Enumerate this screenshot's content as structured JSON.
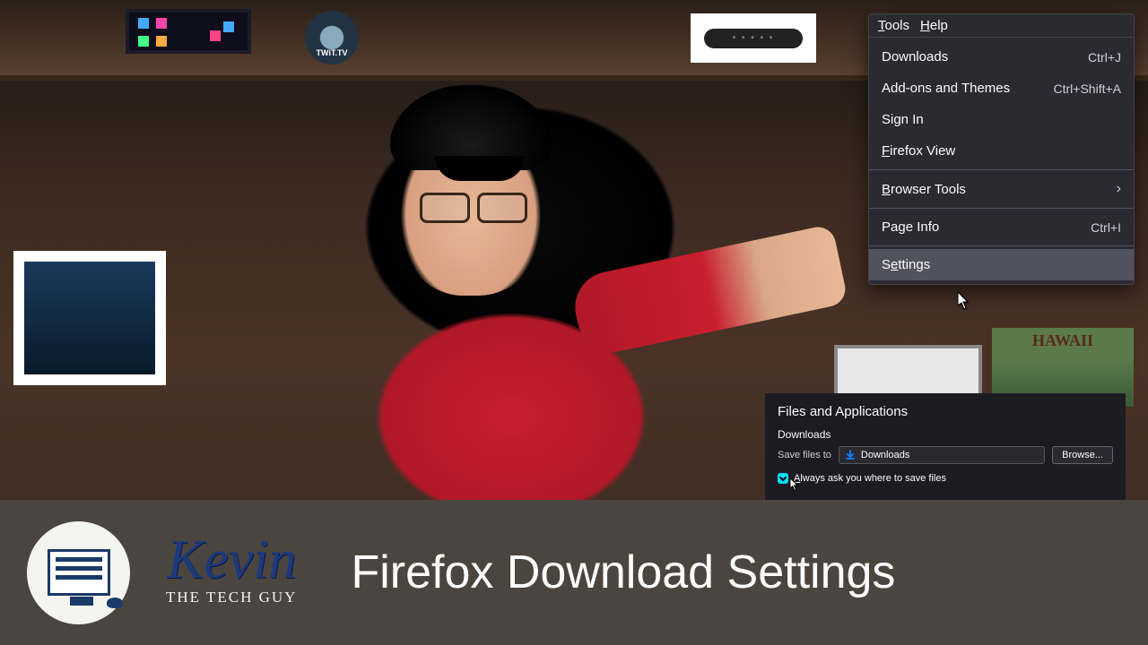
{
  "menubar": {
    "tools": "Tools",
    "help": "Help"
  },
  "menu": {
    "downloads": {
      "label": "Downloads",
      "shortcut": "Ctrl+J"
    },
    "addons": {
      "label": "Add-ons and Themes",
      "shortcut": "Ctrl+Shift+A"
    },
    "signin": {
      "label": "Sign In"
    },
    "fxview": {
      "label": "Firefox View"
    },
    "browsertools": {
      "label": "Browser Tools"
    },
    "pageinfo": {
      "label": "Page Info",
      "shortcut": "Ctrl+I"
    },
    "settings": {
      "label": "Settings"
    }
  },
  "settings": {
    "section_title": "Files and Applications",
    "downloads_label": "Downloads",
    "save_to_label": "Save files to",
    "path_value": "Downloads",
    "browse_label": "Browse...",
    "always_ask": "Always ask you where to save files"
  },
  "banner": {
    "name": "Kevin",
    "subtitle": "THE TECH GUY",
    "title": "Firefox Download Settings"
  },
  "decor": {
    "twit": "TWiT.TV",
    "hawaii": "HAWAII",
    "watch_dots": "• • • • •"
  }
}
